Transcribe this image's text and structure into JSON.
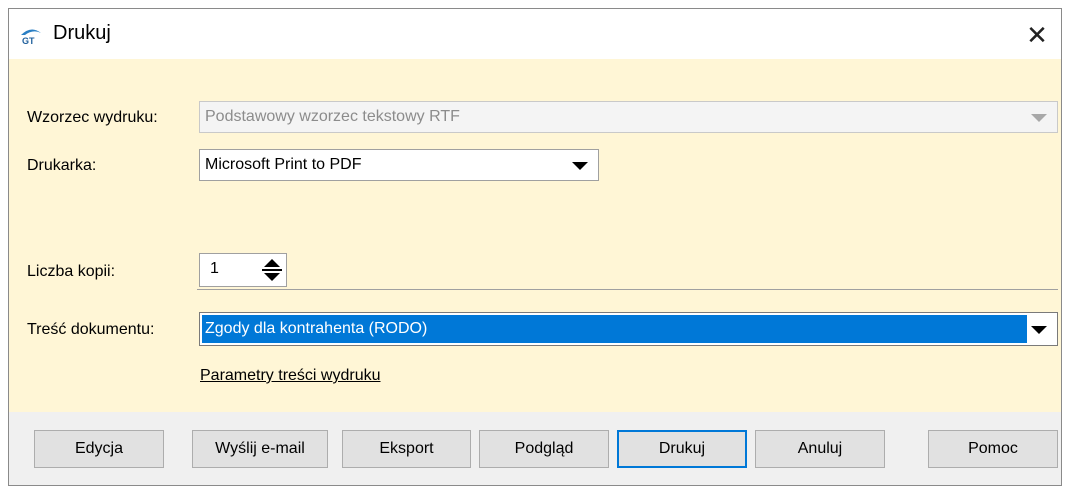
{
  "window": {
    "title": "Drukuj",
    "icon": "app-logo-icon",
    "close_label": "✕"
  },
  "form": {
    "template": {
      "label": "Wzorzec wydruku:",
      "value": "Podstawowy wzorzec tekstowy RTF",
      "enabled": false
    },
    "printer": {
      "label": "Drukarka:",
      "value": "Microsoft Print to PDF"
    },
    "copies": {
      "label": "Liczba kopii:",
      "value": "1"
    },
    "content": {
      "label": "Treść dokumentu:",
      "value": "Zgody dla kontrahenta (RODO)"
    },
    "params_link": "Parametry treści wydruku"
  },
  "buttons": {
    "edit": "Edycja",
    "email": "Wyślij e-mail",
    "export": "Eksport",
    "preview": "Podgląd",
    "print": "Drukuj",
    "cancel": "Anuluj",
    "help": "Pomoc"
  },
  "colors": {
    "form_background": "#fff6d6",
    "selection": "#0078d7",
    "button_bar": "#f0f0f0"
  }
}
